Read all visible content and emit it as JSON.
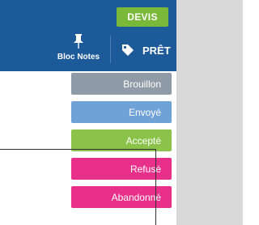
{
  "header": {
    "devis_label": "DEVIS",
    "notes_label": "Bloc Notes",
    "notes_icon": "pushpin-icon",
    "pret_label": "PRÊT",
    "pret_icon": "tag-icon",
    "background_color": "#1d5a99"
  },
  "statuses": [
    {
      "label": "Brouillon",
      "color": "#8f9ba6"
    },
    {
      "label": "Envoyé",
      "color": "#6fa3d8"
    },
    {
      "label": "Accepté",
      "color": "#8bc34a"
    },
    {
      "label": "Refusé",
      "color": "#e8308a"
    },
    {
      "label": "Abandonné",
      "color": "#e8308a"
    }
  ]
}
